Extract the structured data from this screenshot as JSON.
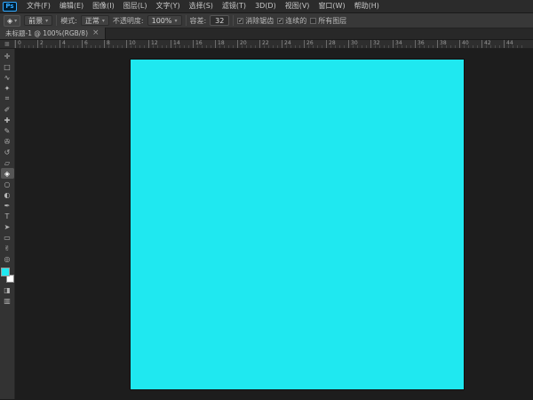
{
  "app": {
    "logo_text": "Ps"
  },
  "menu_bar": {
    "items": [
      "文件(F)",
      "编辑(E)",
      "图像(I)",
      "图层(L)",
      "文字(Y)",
      "选择(S)",
      "滤镜(T)",
      "3D(D)",
      "视图(V)",
      "窗口(W)",
      "帮助(H)"
    ]
  },
  "options_bar": {
    "tool_icon_glyph": "◈",
    "caret_glyph": "▾",
    "fill_source_value": "前景",
    "mode_label": "模式:",
    "mode_value": "正常",
    "opacity_label": "不透明度:",
    "opacity_value": "100%",
    "tolerance_label": "容差:",
    "tolerance_value": "32",
    "checkboxes": [
      {
        "label": "消除锯齿",
        "checked": true
      },
      {
        "label": "连续的",
        "checked": true
      },
      {
        "label": "所有图层",
        "checked": false
      }
    ]
  },
  "document_tab": {
    "title": "未标题-1 @ 100%(RGB/8)",
    "close_glyph": "×"
  },
  "ruler": {
    "corner_glyph": "▩",
    "labels": [
      "0",
      "2",
      "4",
      "6",
      "8",
      "10",
      "12",
      "14",
      "16",
      "18",
      "20",
      "22",
      "24",
      "26",
      "28",
      "30",
      "32",
      "34",
      "36",
      "38",
      "40",
      "42",
      "44"
    ]
  },
  "toolbar": {
    "tools": [
      {
        "name": "move-tool",
        "glyph": "✛",
        "selected": false
      },
      {
        "name": "rectangular-marquee-tool",
        "glyph": "□",
        "selected": false
      },
      {
        "name": "lasso-tool",
        "glyph": "∿",
        "selected": false
      },
      {
        "name": "quick-selection-tool",
        "glyph": "✦",
        "selected": false
      },
      {
        "name": "crop-tool",
        "glyph": "⌗",
        "selected": false
      },
      {
        "name": "eyedropper-tool",
        "glyph": "✐",
        "selected": false
      },
      {
        "name": "healing-brush-tool",
        "glyph": "✚",
        "selected": false
      },
      {
        "name": "brush-tool",
        "glyph": "✎",
        "selected": false
      },
      {
        "name": "clone-stamp-tool",
        "glyph": "✇",
        "selected": false
      },
      {
        "name": "history-brush-tool",
        "glyph": "↺",
        "selected": false
      },
      {
        "name": "eraser-tool",
        "glyph": "▱",
        "selected": false
      },
      {
        "name": "paint-bucket-tool",
        "glyph": "◈",
        "selected": true
      },
      {
        "name": "blur-tool",
        "glyph": "○",
        "selected": false
      },
      {
        "name": "dodge-tool",
        "glyph": "◐",
        "selected": false
      },
      {
        "name": "pen-tool",
        "glyph": "✒",
        "selected": false
      },
      {
        "name": "type-tool",
        "glyph": "T",
        "selected": false
      },
      {
        "name": "path-selection-tool",
        "glyph": "➤",
        "selected": false
      },
      {
        "name": "shape-tool",
        "glyph": "▭",
        "selected": false
      },
      {
        "name": "hand-tool",
        "glyph": "✌",
        "selected": false
      },
      {
        "name": "zoom-tool",
        "glyph": "◎",
        "selected": false
      }
    ],
    "bottom_tools": [
      {
        "name": "quick-mask-button",
        "glyph": "◨",
        "selected": false
      },
      {
        "name": "screen-mode-button",
        "glyph": "▥",
        "selected": false
      }
    ]
  },
  "colors": {
    "canvas_fill": "#1fe8f0",
    "foreground_swatch": "#1fe8f0",
    "background_swatch": "#ffffff"
  }
}
